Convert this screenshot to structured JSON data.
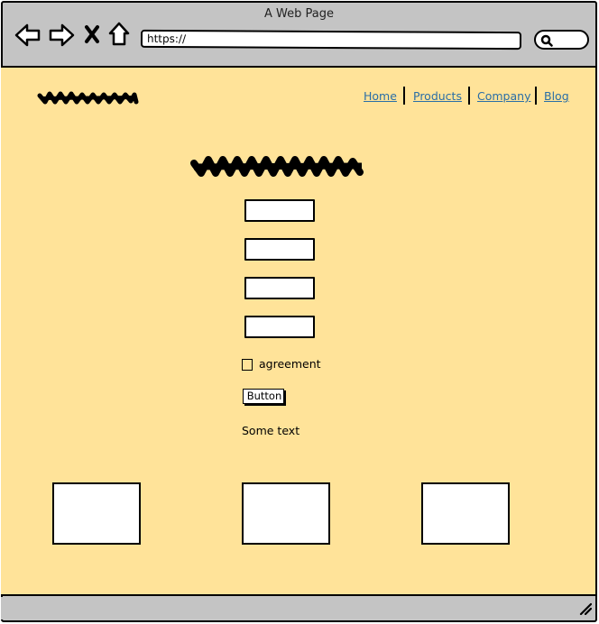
{
  "window": {
    "title": "A Web Page",
    "url": "https://"
  },
  "nav": {
    "items": [
      {
        "label": "Home"
      },
      {
        "label": "Products"
      },
      {
        "label": "Company"
      },
      {
        "label": "Blog"
      }
    ],
    "link_color": "#2a6ea6"
  },
  "form": {
    "field_count": 4,
    "checkbox_label": "agreement",
    "checkbox_checked": false,
    "button_label": "Button",
    "note_text": "Some text"
  },
  "image_placeholder_count": 3,
  "colors": {
    "page_background": "#ffe399",
    "chrome": "#c4c4c4"
  },
  "icons": [
    "back-arrow-icon",
    "forward-arrow-icon",
    "close-icon",
    "home-icon",
    "search-icon",
    "resize-grip-icon"
  ]
}
